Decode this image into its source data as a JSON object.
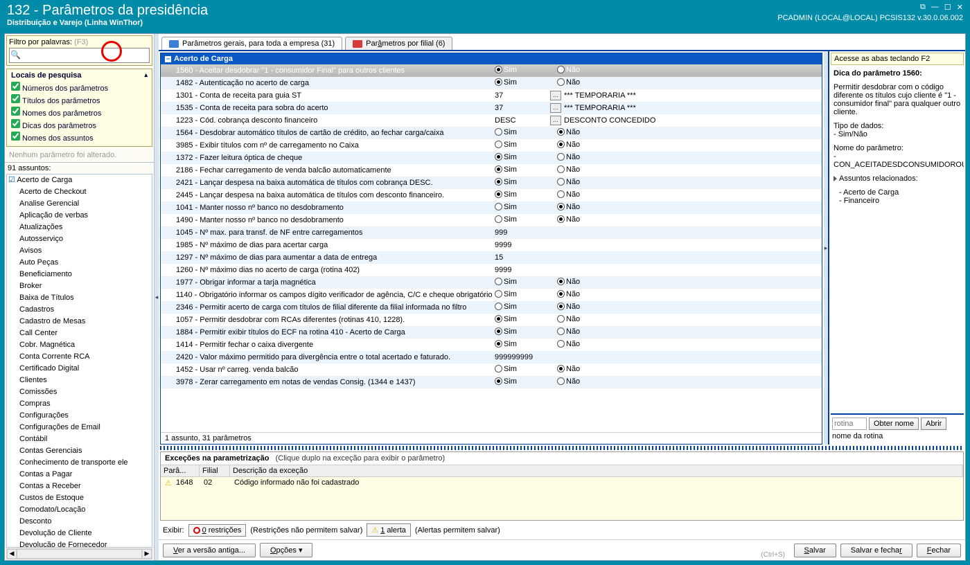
{
  "title": "132 - Parâmetros da presidência",
  "subtitle": "Distribuição e Varejo (Linha WinThor)",
  "version_line": "PCADMIN (LOCAL@LOCAL)   PCSIS132  v.30.0.06.002",
  "filter": {
    "label": "Filtro por palavras:",
    "hint": "(F3)",
    "placeholder": ""
  },
  "search_loc": {
    "header": "Locais de pesquisa",
    "items": [
      "Números dos parâmetros",
      "Títulos dos parâmetros",
      "Nomes dos parâmetros",
      "Dicas dos parâmetros",
      "Nomes dos assuntos"
    ]
  },
  "no_alter": "Nenhum parâmetro foi alterado.",
  "subjects_header": "91 assuntos:",
  "subjects": [
    "Acerto de Carga",
    "Acerto de Checkout",
    "Analise Gerencial",
    "Aplicação de verbas",
    "Atualizações",
    "Autosserviço",
    "Avisos",
    "Auto Peças",
    "Beneficiamento",
    "Broker",
    "Baixa de Títulos",
    "Cadastros",
    "Cadastro de Mesas",
    "Call Center",
    "Cobr. Magnética",
    "Conta Corrente RCA",
    "Certificado Digital",
    "Clientes",
    "Comissões",
    "Compras",
    "Configurações",
    "Configurações de Email",
    "Contábil",
    "Contas Gerenciais",
    "Conhecimento de transporte ele",
    "Contas a Pagar",
    "Contas a Receber",
    "Custos de Estoque",
    "Comodato/Locação",
    "Desconto",
    "Devolução de Cliente",
    "Devolução de Fornecedor"
  ],
  "tabs": {
    "general": "Parâmetros gerais, para toda a empresa  (31)",
    "general_u": "g",
    "branch": "Parâmetros por filial  (6)",
    "branch_u": "a"
  },
  "group_header": "Acerto de Carga",
  "params": [
    {
      "d": "1560 - Aceitar desdobrar \"1 - consumidor Final\" para outros clientes",
      "sim": true,
      "nao": false,
      "sel": true
    },
    {
      "d": "1482 - Autenticação no acerto de carga",
      "sim": true,
      "nao": false
    },
    {
      "d": "1301 - Conta de receita para guia ST",
      "val": "37",
      "dots": true,
      "txt": "*** TEMPORARIA ***"
    },
    {
      "d": "1535 - Conta de receita para sobra do acerto",
      "val": "37",
      "dots": true,
      "txt": "*** TEMPORARIA ***"
    },
    {
      "d": "1223 - Cód. cobrança desconto financeiro",
      "val": "DESC",
      "dots": true,
      "txt": "DESCONTO CONCEDIDO"
    },
    {
      "d": "1564 - Desdobrar automático títulos de cartão de crédito, ao fechar carga/caixa",
      "sim": false,
      "nao": true
    },
    {
      "d": "3985 - Exibir títulos com nº de carregamento no Caixa",
      "sim": false,
      "nao": true
    },
    {
      "d": "1372 - Fazer leitura óptica de cheque",
      "sim": true,
      "nao": false
    },
    {
      "d": "2186 - Fechar carregamento de venda balcão automaticamente",
      "sim": true,
      "nao": false
    },
    {
      "d": "2421 - Lançar despesa na baixa automática de títulos com cobrança DESC.",
      "sim": true,
      "nao": false
    },
    {
      "d": "2445 - Lançar despesa na baixa automática de títulos com desconto financeiro.",
      "sim": true,
      "nao": false
    },
    {
      "d": "1041 - Manter nosso nº banco no desdobramento",
      "sim": false,
      "nao": true
    },
    {
      "d": "1490 - Manter nosso nº banco no desdobramento",
      "sim": false,
      "nao": true
    },
    {
      "d": "1045 - Nº max. para transf. de NF entre carregamentos",
      "val": "999"
    },
    {
      "d": "1985 - Nº máximo de dias para acertar carga",
      "val": "9999"
    },
    {
      "d": "1297 - Nº máximo de dias para aumentar a data de entrega",
      "val": "15"
    },
    {
      "d": "1260 - Nº máximo dias no acerto de carga (rotina 402)",
      "val": "9999"
    },
    {
      "d": "1977 - Obrigar informar a tarja magnética",
      "sim": false,
      "nao": true
    },
    {
      "d": "1140 - Obrigatório informar os campos dígito verificador de agência, C/C e cheque obrigatório",
      "sim": false,
      "nao": true
    },
    {
      "d": "2346 - Permitir acerto de carga com títulos de filial diferente da filial informada no filtro",
      "sim": false,
      "nao": true
    },
    {
      "d": "1057 - Permitir desdobrar com RCAs diferentes (rotinas 410, 1228).",
      "sim": true,
      "nao": false
    },
    {
      "d": "1884 - Permitir exibir títulos do ECF na rotina 410 - Acerto de Carga",
      "sim": true,
      "nao": false
    },
    {
      "d": "1414 - Permitir fechar o caixa divergente",
      "sim": true,
      "nao": false
    },
    {
      "d": "    2420 - Valor máximo permitido para divergência entre o total acertado e faturado.",
      "val": "999999999"
    },
    {
      "d": "1452 - Usar nº carreg. venda balcão",
      "sim": false,
      "nao": true
    },
    {
      "d": "    3978 - Zerar carregamento em notas de vendas Consig. (1344 e 1437)",
      "sim": true,
      "nao": false
    }
  ],
  "grid_status": "1 assunto, 31 parâmetros",
  "exceptions": {
    "title": "Exceções na parametrização",
    "hint": "(Clique duplo na exceção para exibir o parâmetro)",
    "cols": [
      "Parâ...",
      "Filial",
      "Descrição da exceção"
    ],
    "rows": [
      {
        "param": "1648",
        "filial": "02",
        "desc": "Código informado não foi cadastrado"
      }
    ]
  },
  "exhibit": {
    "label": "Exibir:",
    "restr_u": "0",
    "restr": " restrições",
    "restr_hint": "(Restrições não permitem salvar)",
    "alert_u": "1",
    "alert": " alerta",
    "alert_hint": "(Alertas permitem salvar)"
  },
  "footer": {
    "old_u": "V",
    "old": "er a versão antiga...",
    "opt": "Opções",
    "opt_u": "O",
    "save_u": "S",
    "save": "alvar",
    "saveclose": "Salvar e fecha",
    "saveclose_u": "r",
    "close_u": "F",
    "close": "echar",
    "shortcut": "(Ctrl+S)"
  },
  "info": {
    "header": "Acesse as abas teclando F2",
    "tip_title": "Dica do parâmetro 1560:",
    "tip_body": "Permitir desdobrar com o código diferente os títulos cujo cliente é \"1 - consumidor final\" para qualquer outro cliente.",
    "datatype_lbl": "Tipo de dados:",
    "datatype_val": "- Sim/Não",
    "name_lbl": "Nome do parâmetro:",
    "name_val": "CON_ACEITADESDCONSUMIDOROUT",
    "rel_lbl": "Assuntos relacionados:",
    "rel": [
      "Acerto de Carga",
      "Financeiro"
    ],
    "routine_placeholder": "rotina",
    "get_name": "Obter nome",
    "open_u": "A",
    "open": "brir",
    "routine_name": "nome da rotina"
  }
}
